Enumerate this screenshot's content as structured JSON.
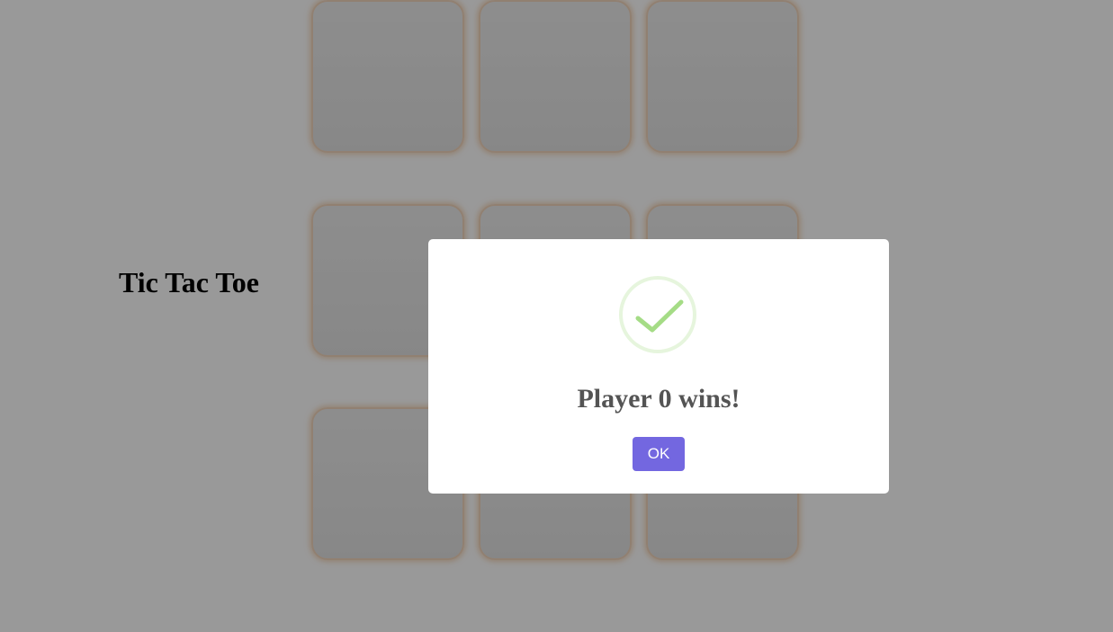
{
  "page": {
    "title": "Tic Tac Toe"
  },
  "board": {
    "cells": [
      "",
      "",
      "",
      "",
      "",
      "",
      "",
      "",
      ""
    ]
  },
  "dialog": {
    "icon": "success-check-icon",
    "title": "Player 0 wins!",
    "ok_label": "OK"
  },
  "colors": {
    "overlay": "#999999",
    "cell_border": "#f2d6bd",
    "success_green": "#a5dc86",
    "success_ring": "#e6f5dd",
    "confirm_button": "#7367e0",
    "dialog_title": "#545454"
  }
}
